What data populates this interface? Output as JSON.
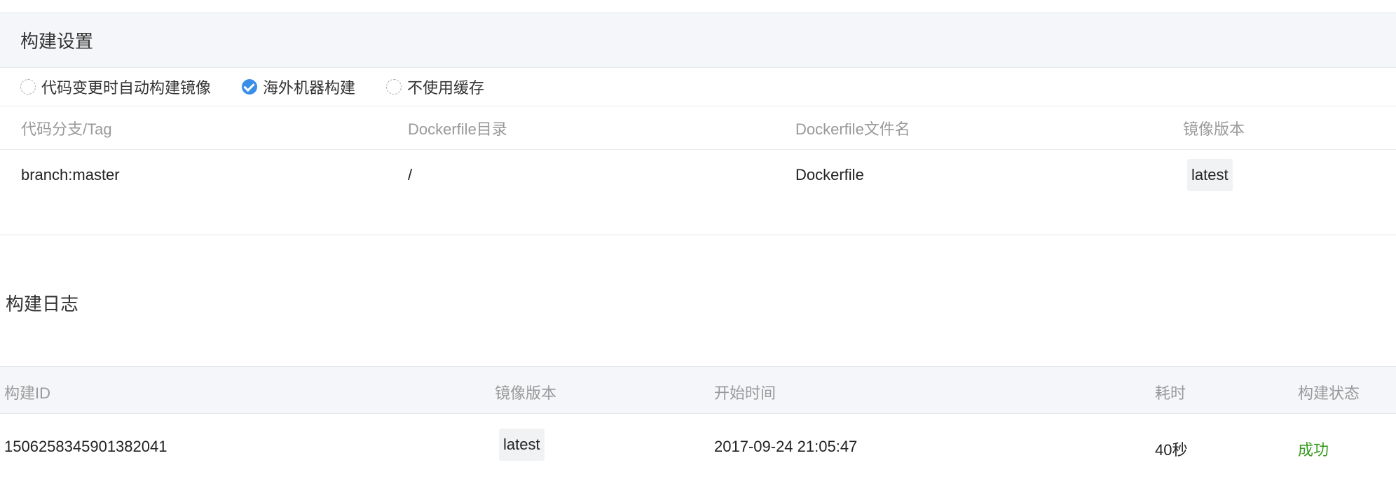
{
  "settings": {
    "title": "构建设置",
    "options": [
      {
        "label": "代码变更时自动构建镜像",
        "checked": false
      },
      {
        "label": "海外机器构建",
        "checked": true
      },
      {
        "label": "不使用缓存",
        "checked": false
      }
    ],
    "table": {
      "columns": [
        "代码分支/Tag",
        "Dockerfile目录",
        "Dockerfile文件名",
        "镜像版本"
      ],
      "row": {
        "branch": "branch:master",
        "dir": "/",
        "filename": "Dockerfile",
        "version": "latest"
      }
    }
  },
  "log": {
    "title": "构建日志",
    "columns": [
      "构建ID",
      "镜像版本",
      "开始时间",
      "耗时",
      "构建状态"
    ],
    "rows": [
      {
        "id": "1506258345901382041",
        "version": "latest",
        "start": "2017-09-24 21:05:47",
        "duration": "40秒",
        "status": "成功"
      }
    ]
  },
  "colors": {
    "accent": "#3a8ee6",
    "success": "#3a9b22",
    "header_bg": "#f4f6f9"
  }
}
